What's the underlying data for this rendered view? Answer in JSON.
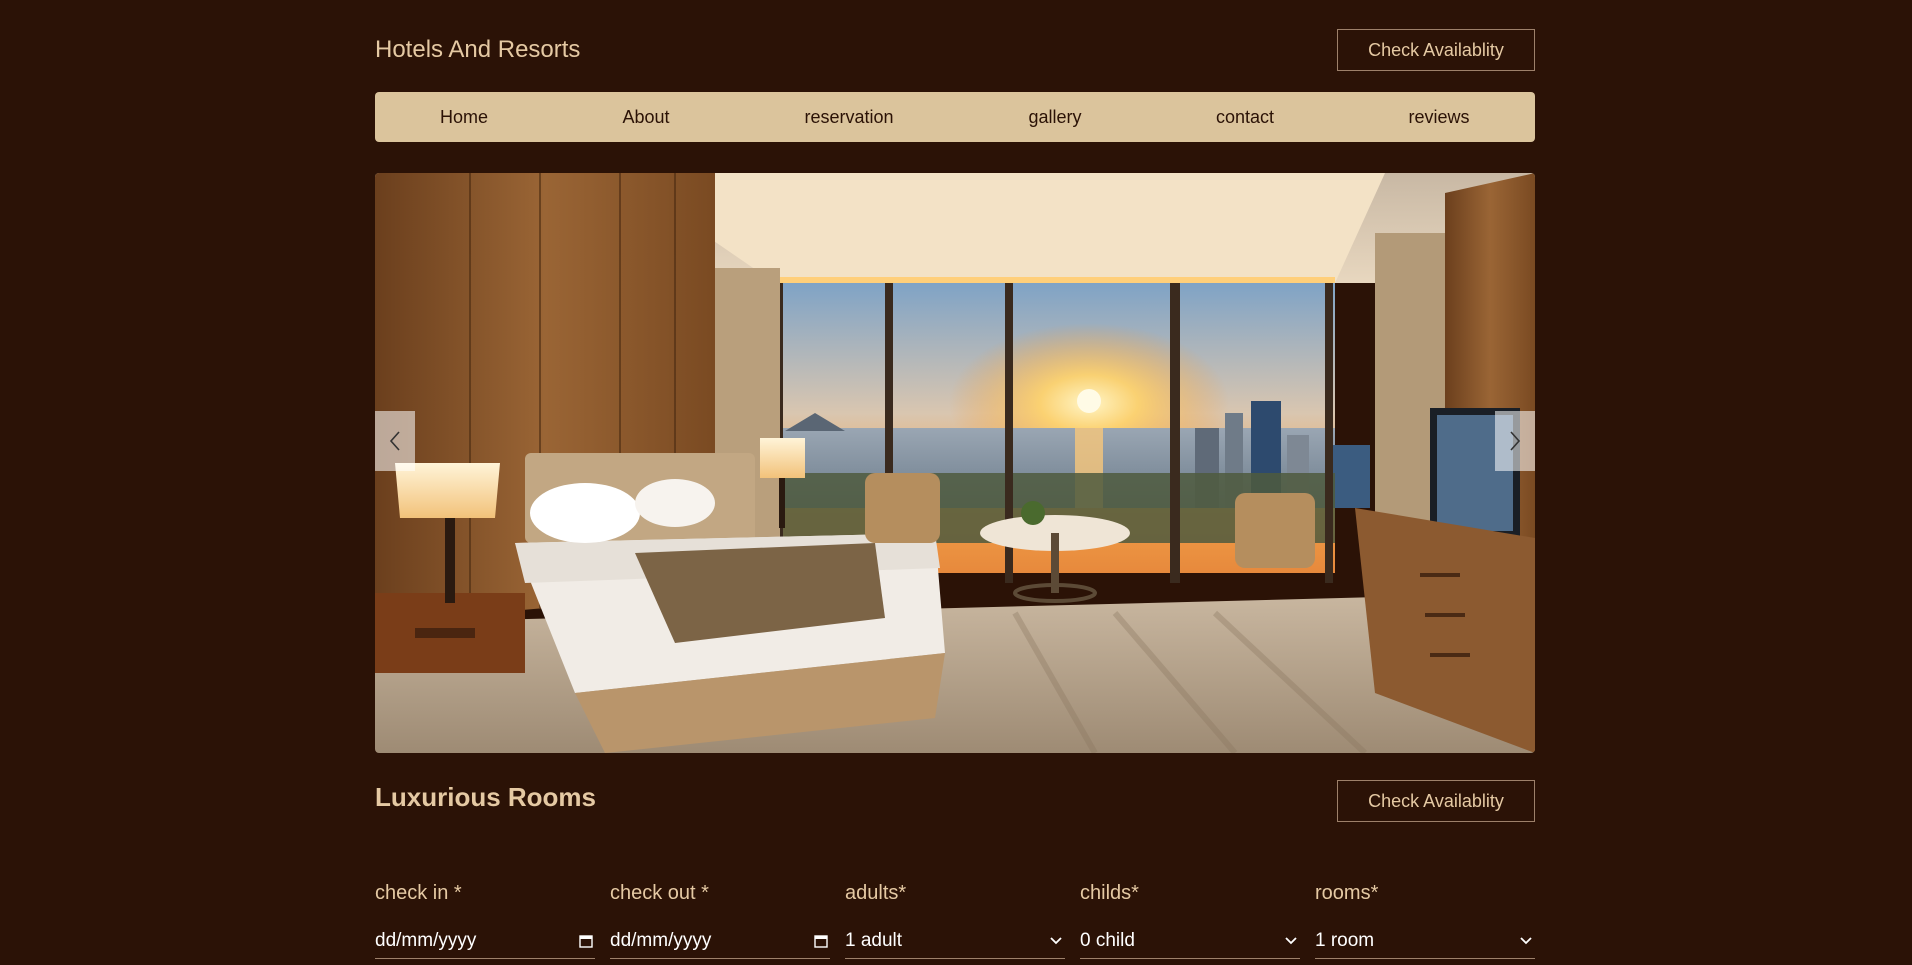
{
  "header": {
    "brand": "Hotels And Resorts",
    "check_availability": "Check Availablity"
  },
  "nav": {
    "items": [
      {
        "label": "Home"
      },
      {
        "label": "About"
      },
      {
        "label": "reservation"
      },
      {
        "label": "gallery"
      },
      {
        "label": "contact"
      },
      {
        "label": "reviews"
      }
    ]
  },
  "slider": {
    "prev_icon": "chevron-left-icon",
    "next_icon": "chevron-right-icon"
  },
  "section": {
    "title": "Luxurious Rooms",
    "check_availability": "Check Availablity"
  },
  "booking_form": {
    "fields": [
      {
        "label": "check in *",
        "value": "dd/mm/yyyy",
        "icon": "calendar-icon"
      },
      {
        "label": "check out *",
        "value": "dd/mm/yyyy",
        "icon": "calendar-icon"
      },
      {
        "label": "adults*",
        "value": "1 adult",
        "icon": "chevron-down-icon"
      },
      {
        "label": "childs*",
        "value": "0 child",
        "icon": "chevron-down-icon"
      },
      {
        "label": "rooms*",
        "value": "1 room",
        "icon": "chevron-down-icon"
      }
    ]
  },
  "colors": {
    "background": "#2b1206",
    "nav_background": "#dbc49c",
    "accent_text": "#e5c9a3",
    "border": "#9d806a"
  }
}
